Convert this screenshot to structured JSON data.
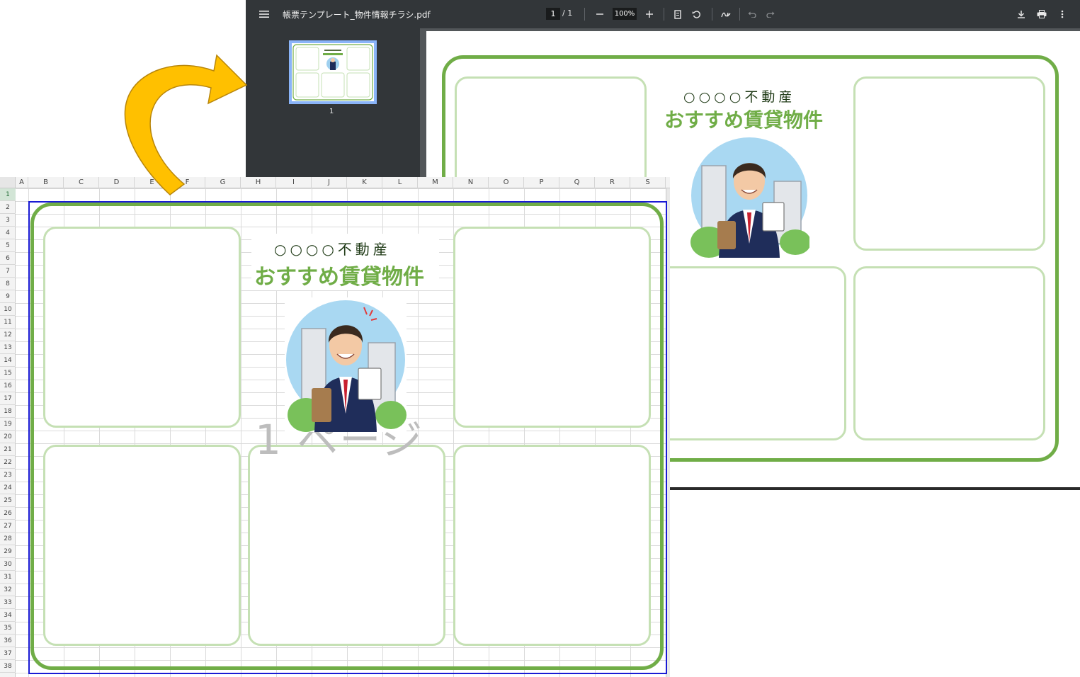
{
  "pdf_viewer": {
    "filename": "帳票テンプレート_物件情報チラシ.pdf",
    "page_current": "1",
    "page_total": "/ 1",
    "zoom": "100%",
    "thumbnail_page": "1",
    "icons": [
      "menu-icon",
      "zoom-out-icon",
      "zoom-in-icon",
      "fit-page-icon",
      "rotate-icon",
      "annotate-icon",
      "undo-icon",
      "redo-icon",
      "download-icon",
      "print-icon",
      "more-icon"
    ]
  },
  "flyer": {
    "company": "○○○○不動産",
    "title": "おすすめ賃貸物件"
  },
  "excel": {
    "columns": [
      "A",
      "B",
      "C",
      "D",
      "E",
      "F",
      "G",
      "H",
      "I",
      "J",
      "K",
      "L",
      "M",
      "N",
      "O",
      "P",
      "Q",
      "R",
      "S"
    ],
    "rows": [
      "1",
      "2",
      "3",
      "4",
      "5",
      "6",
      "7",
      "8",
      "9",
      "10",
      "11",
      "12",
      "13",
      "14",
      "15",
      "16",
      "17",
      "18",
      "19",
      "20",
      "21",
      "22",
      "23",
      "24",
      "25",
      "26",
      "27",
      "28",
      "29",
      "30",
      "31",
      "32",
      "33",
      "34",
      "35",
      "36",
      "37",
      "38"
    ],
    "page_watermark": "1 ページ"
  },
  "colors": {
    "frame_green": "#70ad47",
    "cell_green": "#c5e0b4",
    "arrow_gold": "#ffc000",
    "print_area_blue": "#1a1ad4",
    "viewer_toolbar": "#323639"
  }
}
